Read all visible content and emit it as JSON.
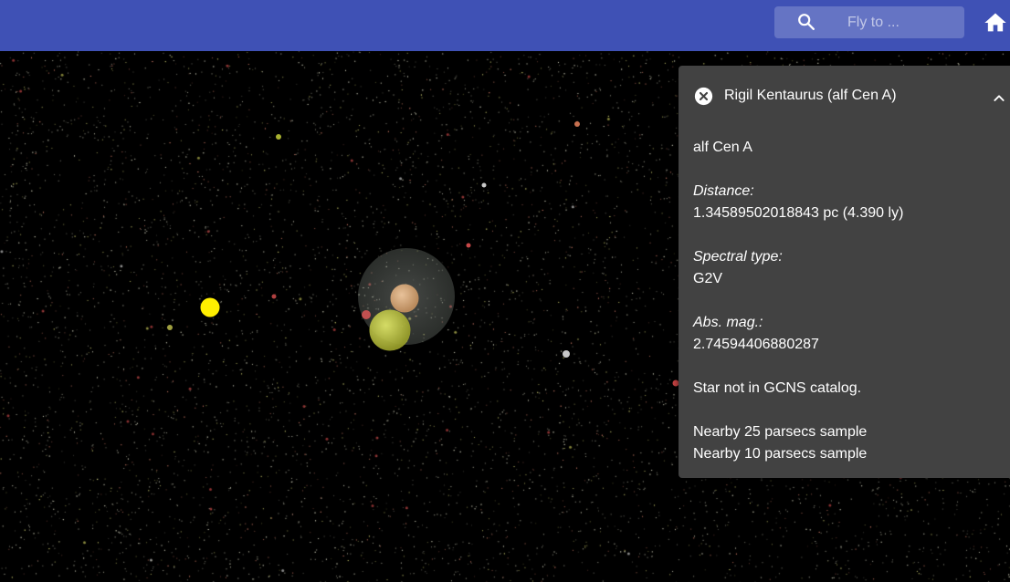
{
  "search": {
    "placeholder": "Fly to ...",
    "icon": "search-icon"
  },
  "home": {
    "icon": "home-icon"
  },
  "panel": {
    "title": "Rigil Kentaurus (alf Cen A)",
    "close_icon": "close-circle-icon",
    "collapse_icon": "chevron-up-icon",
    "designation": "alf Cen A",
    "distance_label": "Distance:",
    "distance_value": "1.34589502018843 pc (4.390 ly)",
    "spectral_label": "Spectral type:",
    "spectral_value": "G2V",
    "absmag_label": "Abs. mag.:",
    "absmag_value": "2.74594406880287",
    "catalog_note": "Star not in GCNS catalog.",
    "links": [
      "Nearby 25 parsecs sample",
      "Nearby 10 parsecs sample"
    ]
  },
  "colors": {
    "topbar": "#3f51b5",
    "search_bg": "#6574c4",
    "panel_bg": "#424242",
    "sun": "#ffee00"
  }
}
